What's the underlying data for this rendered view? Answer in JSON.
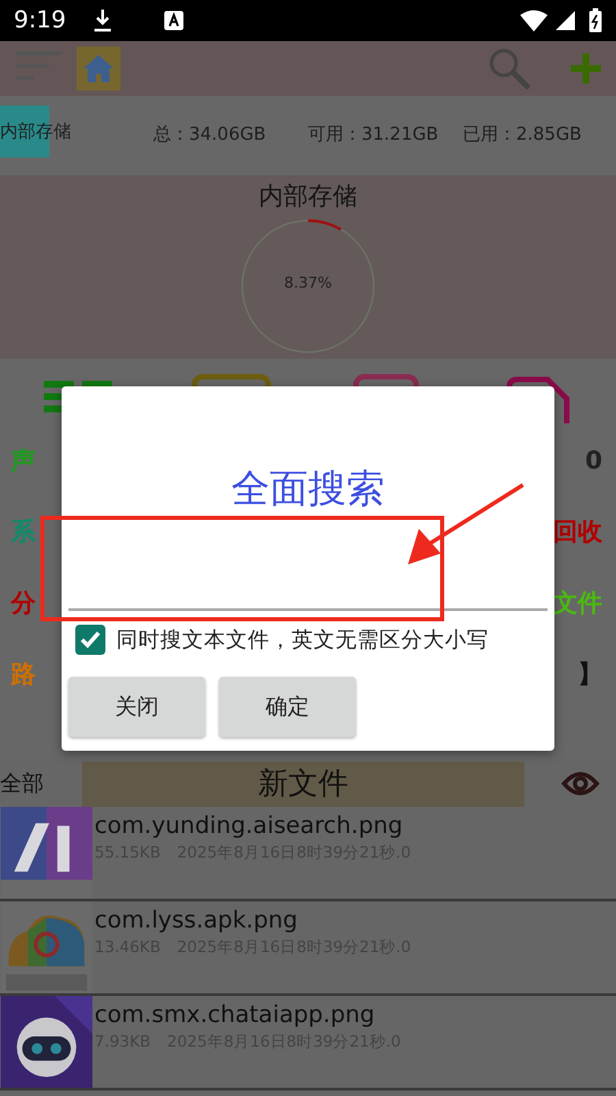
{
  "status_bar": {
    "time": "9:19"
  },
  "storage": {
    "name": "内部存储",
    "total": "总：34.06GB",
    "free": "可用：31.21GB",
    "used": "已用：2.85GB"
  },
  "storage_chart": {
    "title": "内部存储",
    "percent": "8.37%",
    "level": 0.0837
  },
  "categories": {
    "rows": [
      {
        "left": {
          "text": "声",
          "color": "#1f9a1f"
        },
        "right": {
          "text": "0",
          "color": "#222222"
        }
      },
      {
        "left": {
          "text": "系",
          "color": "#0f8a6a"
        },
        "right": {
          "text": "回收",
          "color": "#b00000"
        }
      },
      {
        "left": {
          "text": "分",
          "color": "#b00000"
        },
        "right": {
          "text": "文件",
          "color": "#4aba10"
        }
      },
      {
        "left": {
          "text": "路",
          "color": "#d07000"
        },
        "right": {
          "text": "】",
          "color": "#111111"
        }
      }
    ]
  },
  "search_dialog": {
    "title": "全面搜索",
    "option": {
      "label": "同时搜文本文件，英文无需区分大小写",
      "checked": true
    },
    "buttons": [
      "关闭",
      "确定"
    ]
  },
  "file_list": {
    "filter": "全部",
    "title": "新文件",
    "files": [
      {
        "name": "com.yunding.aisearch.png",
        "size": "55.15KB",
        "date": "2025年8月16日8时39分21秒.0",
        "kind": "picture"
      },
      {
        "name": "com.lyss.apk.png",
        "size": "13.46KB",
        "date": "2025年8月16日8时39分21秒.0",
        "kind": "picture"
      },
      {
        "name": "com.smx.chataiapp.png",
        "size": "7.93KB",
        "date": "2025年8月16日8时39分21秒.0",
        "kind": "picture"
      }
    ]
  }
}
